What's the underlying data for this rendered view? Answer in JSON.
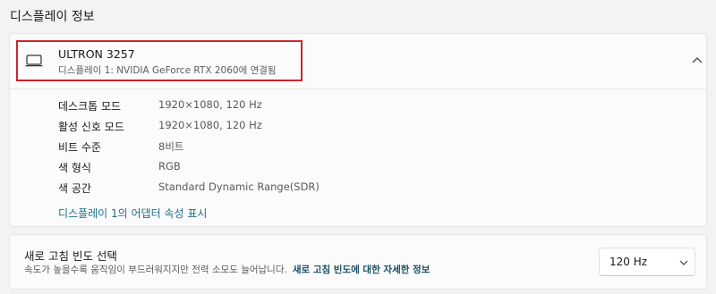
{
  "section": {
    "title": "디스플레이 정보"
  },
  "display": {
    "name": "ULTRON 3257",
    "connection": "디스플레이 1: NVIDIA GeForce RTX 2060에 연결됨",
    "properties": [
      {
        "label": "데스크톱 모드",
        "value": "1920×1080, 120 Hz"
      },
      {
        "label": "활성 신호 모드",
        "value": "1920×1080, 120 Hz"
      },
      {
        "label": "비트 수준",
        "value": "8비트"
      },
      {
        "label": "색 형식",
        "value": "RGB"
      },
      {
        "label": "색 공간",
        "value": "Standard Dynamic Range(SDR)"
      }
    ],
    "adapter_link": "디스플레이 1의 어댑터 속성 표시"
  },
  "refresh_rate": {
    "title": "새로 고침 빈도 선택",
    "description": "속도가 높을수록 움직임이 부드러워지지만 전력 소모도 늘어납니다.",
    "link": "새로 고침 빈도에 대한 자세한 정보",
    "selected": "120 Hz"
  },
  "icons": {
    "monitor": "monitor-icon",
    "collapse": "chevron-up-icon",
    "dropdown": "chevron-down-icon"
  },
  "colors": {
    "highlight": "#c8262f",
    "link": "#1f6f8b"
  }
}
